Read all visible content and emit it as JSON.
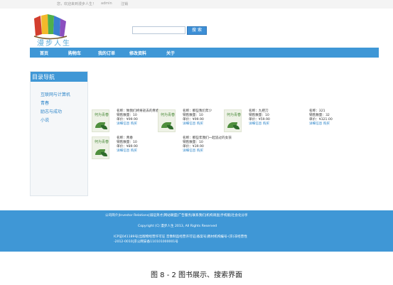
{
  "topbar": {
    "welcome": "您，欢迎来到漫步人生！",
    "user": "admin",
    "logout": "注销"
  },
  "header": {
    "brand": "漫步人生",
    "search_placeholder": "",
    "search_button": "搜 索"
  },
  "nav": {
    "items": [
      "首页",
      "购物车",
      "我的订单",
      "修改资料",
      "关于"
    ]
  },
  "sidebar": {
    "title": "目录导航",
    "items": [
      "互联网与计算机",
      "青春",
      "励志与成功",
      "小说"
    ]
  },
  "books": [
    {
      "cover_title": "何为青春",
      "name": "名称：致我们终将逝去的青春",
      "sales": "销售数量：10",
      "price": "单价：¥99.90",
      "links": "详细信息 购买"
    },
    {
      "cover_title": "何为青春",
      "name": "名称：那些我们年少",
      "sales": "销售数量：10",
      "price": "单价：¥99.90",
      "links": "详细信息 购买"
    },
    {
      "cover_title": "何为青春",
      "name": "名称：九把刀",
      "sales": "销售数量：10",
      "price": "单价：¥59.90",
      "links": "详细信息 购买"
    },
    {
      "cover_title": "",
      "name": "名称：321",
      "sales": "销售数量：32",
      "price": "单价：¥321.00",
      "links": "详细信息 购买"
    },
    {
      "cover_title": "何为青春",
      "name": "名称：青春",
      "sales": "销售数量：10",
      "price": "单价：¥89.90",
      "links": "详细信息 购买"
    },
    {
      "cover_title": "何为青春",
      "name": "名称：那些年我们一起追过的女孩",
      "sales": "销售数量：10",
      "price": "单价：¥39.90",
      "links": "详细信息 购买"
    }
  ],
  "footer": {
    "line1": "公司简介|Investor Relations|诚征英才|网站联盟|广告服务|联系我们|机构调查|手机版|社会化分享",
    "line2": "Copyright (C) 漫步人生 2013, All Rights Reserved",
    "line3": "ICP证041189号|出版物经营许可证 音像制品经营许可证|备案号|教材机构编号-(京)非经营性",
    "line4": "-2012-0010|京公网安备110101000001号"
  },
  "caption": "图 8 - 2  图书展示、搜索界面"
}
